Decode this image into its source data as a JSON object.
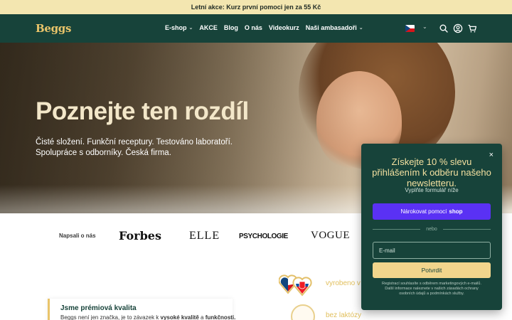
{
  "announcement": "Letní akce: Kurz první pomoci jen za 55 Kč",
  "brand": "Beggs",
  "nav": [
    {
      "label": "E-shop",
      "has_dropdown": true
    },
    {
      "label": "AKCE",
      "has_dropdown": false
    },
    {
      "label": "Blog",
      "has_dropdown": false
    },
    {
      "label": "O nás",
      "has_dropdown": false
    },
    {
      "label": "Videokurz",
      "has_dropdown": false
    },
    {
      "label": "Naši ambasadoři",
      "has_dropdown": true
    }
  ],
  "header_icons": [
    "language-flag-cz",
    "search-icon",
    "account-icon",
    "cart-icon"
  ],
  "hero": {
    "title": "Poznejte ten rozdíl",
    "subtitle_line1": "Čisté složení. Funkční receptury. Testováno laboratoří.",
    "subtitle_line2": "Spolupráce s odborníky. Česká firma."
  },
  "press": {
    "label": "Napsali o nás",
    "logos": [
      "Forbes",
      "ELLE",
      "PSYCHOLOGIE",
      "VOGUE"
    ]
  },
  "features": {
    "card_title": "Jsme prémiová kvalita",
    "card_text_prefix": "Beggs není jen značka, je to závazek k ",
    "card_text_bold1": "vysoké kvalitě",
    "card_text_mid": " a ",
    "card_text_bold2": "funkčnosti.",
    "badge1_label": "vyrobeno v",
    "badge2_label": "bez laktózy"
  },
  "popup": {
    "title": "Získejte 10 % slevu přihlášením k odběru našeho newsletteru.",
    "subtitle": "Vyplňte formulář níže",
    "shop_button_prefix": "Nárokovat pomocí",
    "shop_button_brand": "shop",
    "divider": "nebo",
    "email_placeholder": "E-mail",
    "submit": "Potvrdit",
    "legal": "Registrací souhlasíte s odběrem marketingových e-mailů. Další informace naleznete v našich zásadách ochrany osobních údajů a podmínkách služby.",
    "close": "×"
  },
  "colors": {
    "header_bg": "#17433a",
    "announcement_bg": "#f3e6b0",
    "brand_gold": "#e9c46a",
    "shop_purple": "#5a31f4",
    "submit_yellow": "#f2d58c"
  }
}
